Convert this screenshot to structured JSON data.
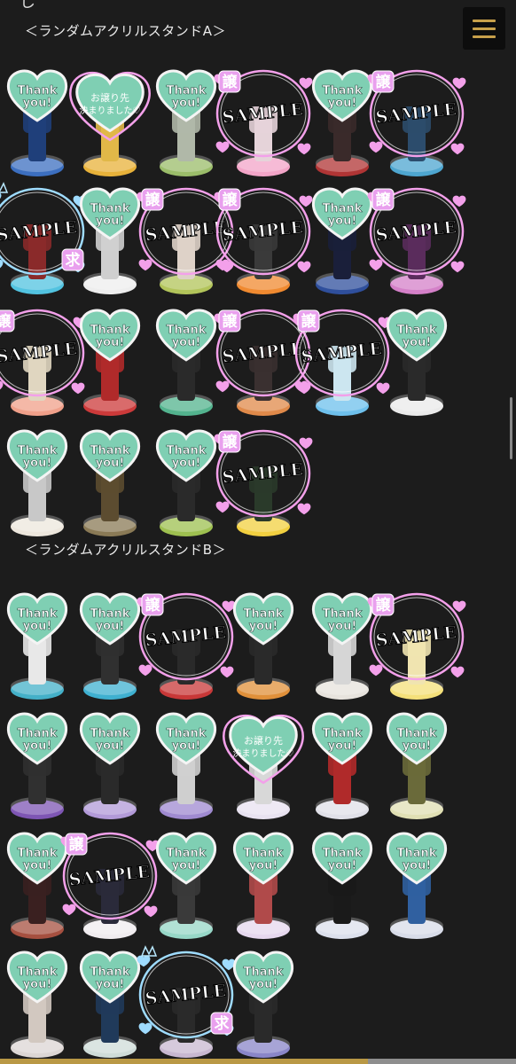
{
  "top_fragment": "し",
  "menu": {
    "icon": "hamburger-menu-icon",
    "color": "#c7a04a"
  },
  "sections": [
    {
      "title": "＜ランダムアクリルスタンドA＞",
      "items": [
        {
          "type": "thanks",
          "base": "#3c6fc0",
          "body": "#1f3f7a"
        },
        {
          "type": "decided",
          "base": "#e8b23a",
          "body": "#e1b848",
          "decided_text_1": "お譲り先",
          "decided_text_2": "決まりました♡"
        },
        {
          "type": "thanks",
          "base": "#9bbd6a",
          "body": "#b0b8a8"
        },
        {
          "type": "sample",
          "base": "#f3a5c8",
          "body": "#e5d3d9",
          "badge": "譲"
        },
        {
          "type": "thanks",
          "base": "#b03535",
          "body": "#3a2a2a"
        },
        {
          "type": "sample",
          "base": "#4ea6d0",
          "body": "#2c4c6c",
          "badge": "譲"
        },
        {
          "type": "sample_wanted",
          "base": "#52c3e0",
          "body": "#8a2a2a",
          "badge": "求"
        },
        {
          "type": "thanks",
          "base": "#eeeeee",
          "body": "#cfcfcf"
        },
        {
          "type": "sample",
          "base": "#b2c45a",
          "body": "#ded2c8",
          "badge": "譲"
        },
        {
          "type": "sample",
          "base": "#f08a30",
          "body": "#3a3a3a",
          "badge": "譲"
        },
        {
          "type": "thanks",
          "base": "#2f4f9c",
          "body": "#1a1f3a"
        },
        {
          "type": "sample",
          "base": "#d480c8",
          "body": "#5a2c5c",
          "badge": "譲"
        },
        {
          "type": "sample",
          "base": "#f0a08a",
          "body": "#e0d6c0",
          "badge": "譲"
        },
        {
          "type": "thanks",
          "base": "#cc3a3a",
          "body": "#b02a2a"
        },
        {
          "type": "thanks",
          "base": "#53b38e",
          "body": "#2a2a2a"
        },
        {
          "type": "sample",
          "base": "#e08a4a",
          "body": "#3a3030",
          "badge": "譲"
        },
        {
          "type": "sample",
          "base": "#6ec0ec",
          "body": "#cce6f0",
          "badge": "譲"
        },
        {
          "type": "thanks",
          "base": "#eaeaea",
          "body": "#2a2a2a"
        },
        {
          "type": "thanks",
          "base": "#ede7dd",
          "body": "#c8c8c8"
        },
        {
          "type": "thanks",
          "base": "#8a7a56",
          "body": "#5c4c30"
        },
        {
          "type": "thanks",
          "base": "#9ec050",
          "body": "#2a2a2a"
        },
        {
          "type": "sample",
          "base": "#f2d040",
          "body": "#2a3a2a",
          "badge": "譲"
        }
      ]
    },
    {
      "title": "＜ランダムアクリルスタンドB＞",
      "items": [
        {
          "type": "thanks",
          "base": "#44b0c8",
          "body": "#e8e8e8"
        },
        {
          "type": "thanks",
          "base": "#3fb0d0",
          "body": "#303030"
        },
        {
          "type": "sample",
          "base": "#c83838",
          "body": "#2a2a2a",
          "badge": "譲"
        },
        {
          "type": "thanks",
          "base": "#e0903a",
          "body": "#2a2a2a"
        },
        {
          "type": "thanks",
          "base": "#e7e3dd",
          "body": "#d6d6d6"
        },
        {
          "type": "sample",
          "base": "#f4e07a",
          "body": "#f0e4b0",
          "badge": "譲"
        },
        {
          "type": "thanks",
          "base": "#7e56b4",
          "body": "#303030"
        },
        {
          "type": "thanks",
          "base": "#b29ad8",
          "body": "#2a2a2a"
        },
        {
          "type": "thanks",
          "base": "#9f8ad0",
          "body": "#cfcfcf"
        },
        {
          "type": "decided",
          "base": "#e8e2f0",
          "body": "#d8d8d8",
          "decided_text_1": "お譲り先",
          "decided_text_2": "決まりました♡"
        },
        {
          "type": "thanks",
          "base": "#e0e0e8",
          "body": "#b02a2a"
        },
        {
          "type": "thanks",
          "base": "#e0dfb4",
          "body": "#6a6a3a"
        },
        {
          "type": "thanks",
          "base": "#a65040",
          "body": "#3a2020"
        },
        {
          "type": "sample",
          "base": "#f0ecef",
          "body": "#2a2a3a",
          "badge": "譲"
        },
        {
          "type": "thanks",
          "base": "#97d7c7",
          "body": "#3a3a3a"
        },
        {
          "type": "thanks",
          "base": "#e6d8ee",
          "body": "#b04a4a"
        },
        {
          "type": "thanks",
          "base": "#dce0ec",
          "body": "#1a1a1a"
        },
        {
          "type": "thanks",
          "base": "#d8dce8",
          "body": "#3060a0"
        },
        {
          "type": "thanks",
          "base": "#dcd6d4",
          "body": "#d2c8c0"
        },
        {
          "type": "thanks",
          "base": "#cfdcd8",
          "body": "#203a5a"
        },
        {
          "type": "sample_wanted",
          "base": "#c8b8d0",
          "body": "#2a2a2a",
          "badge": "求"
        },
        {
          "type": "thanks",
          "base": "#8a86c8",
          "body": "#2a2a2a"
        }
      ]
    }
  ],
  "labels": {
    "thanks_line1": "Thank",
    "thanks_line2": "you!",
    "sample": "SAMPLE"
  },
  "colors": {
    "heart_fill": "#7fcfb3",
    "heart_border": "#f4f4f4",
    "neon_pink": "#f3a0ea",
    "neon_blue": "#9fdcff",
    "badge_bg": "#e9a0ee"
  }
}
